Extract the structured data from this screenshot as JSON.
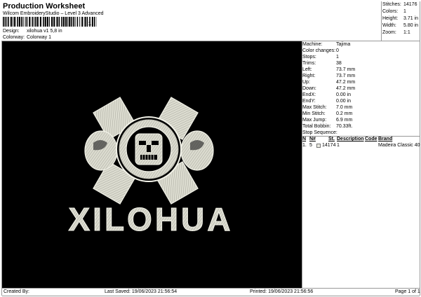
{
  "header": {
    "title": "Production Worksheet",
    "subtitle": "Wilcom EmbroideryStudio – Level 3 Advanced",
    "barcode_digit": "1"
  },
  "design_meta": {
    "design_label": "Design:",
    "design_value": "xilohua v1 5,8 in",
    "colorway_label": "Colorway:",
    "colorway_value": "Colorway 1"
  },
  "summary": [
    {
      "label": "Stitches:",
      "value": "14176"
    },
    {
      "label": "Colors:",
      "value": "1"
    },
    {
      "label": "Height:",
      "value": "3.71 in"
    },
    {
      "label": "Width:",
      "value": "5.80 in"
    },
    {
      "label": "Zoom:",
      "value": "1:1"
    }
  ],
  "machine_info": [
    {
      "label": "Machine:",
      "value": "Tajima"
    },
    {
      "label": "Color changes:",
      "value": "0"
    },
    {
      "label": "Stops:",
      "value": "1"
    },
    {
      "label": "Trims:",
      "value": "38"
    },
    {
      "label": "Left:",
      "value": "73.7 mm"
    },
    {
      "label": "Right:",
      "value": "73.7 mm"
    },
    {
      "label": "Up:",
      "value": "47.2 mm"
    },
    {
      "label": "Down:",
      "value": "47.2 mm"
    },
    {
      "label": "EndX:",
      "value": "0.00 in"
    },
    {
      "label": "EndY:",
      "value": "0.00 in"
    },
    {
      "label": "Max Stitch:",
      "value": "7.0 mm"
    },
    {
      "label": "Min Stitch:",
      "value": "0.2 mm"
    },
    {
      "label": "Max Jump:",
      "value": "6.9 mm"
    },
    {
      "label": "Total Bobbin:",
      "value": "70.33ft."
    }
  ],
  "stop_sequence": {
    "label": "Stop Sequence:",
    "columns": {
      "n": "N",
      "num": "N#",
      "st": "St.",
      "description": "Description",
      "code": "Code",
      "brand": "Brand"
    },
    "rows": [
      {
        "n": "1.",
        "num": "5",
        "st": "14174",
        "description": "1",
        "code": "",
        "brand": "Madeira Classic 40"
      }
    ]
  },
  "artwork": {
    "text": "XILOHUA",
    "thread_color": "#e3e3d8",
    "background": "#000000"
  },
  "footer": {
    "created_by": "Created By:",
    "last_saved": "Last Saved: 19/06/2023 21:56:54",
    "printed": "Printed: 19/06/2023 21:56:56",
    "page": "Page 1 of 1"
  }
}
